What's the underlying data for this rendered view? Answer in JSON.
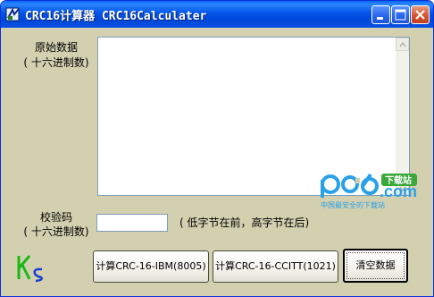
{
  "window": {
    "title": "CRC16计算器 CRC16Calculater"
  },
  "titlebar_buttons": [
    "minimize",
    "maximize",
    "close"
  ],
  "labels": {
    "original_data": "原始数据",
    "original_hex": "( 十六进制数)",
    "check_code": "校验码",
    "check_hex": "( 十六进制数)"
  },
  "fields": {
    "original_data_value": "",
    "check_code_value": ""
  },
  "note": "( 低字节在前，高字节在后)",
  "buttons": {
    "calc_ibm": "计算CRC-16-IBM(8005)",
    "calc_ccitt": "计算CRC-16-CCITT(1021)",
    "clear": "清空数据"
  },
  "logo_text": "KS",
  "watermark": {
    "brand": "pc6.com",
    "badge": "下载站",
    "tagline": "中国最安全的下载站"
  },
  "colors": {
    "dialog_bg": "#d3d0b0",
    "titlebar": "#0054e3",
    "logo_green": "#18b818",
    "watermark_blue": "#2aa0e8"
  }
}
